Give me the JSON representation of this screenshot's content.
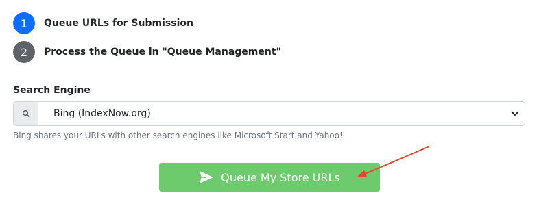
{
  "steps": [
    {
      "number": "1",
      "label": "Queue URLs for Submission",
      "color": "#0d6efd"
    },
    {
      "number": "2",
      "label": "Process the Queue in \"Queue Management\"",
      "color": "#5f6368"
    }
  ],
  "search_engine": {
    "label": "Search Engine",
    "selected": "Bing (IndexNow.org)",
    "help": "Bing shares your URLs with other search engines like Microsoft Start and Yahoo!",
    "addon_icon": "search-icon"
  },
  "submit": {
    "label": "Queue My Store URLs",
    "icon": "send-icon",
    "color": "#6dca6d"
  },
  "annotation": {
    "color": "#e8452c"
  }
}
